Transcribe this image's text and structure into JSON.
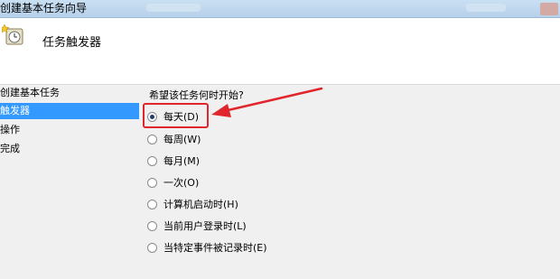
{
  "window": {
    "title": "创建基本任务向导"
  },
  "header": {
    "title": "任务触发器",
    "icon": "task-clock-icon"
  },
  "nav": {
    "items": [
      {
        "label": "创建基本任务",
        "selected": false
      },
      {
        "label": "触发器",
        "selected": true
      },
      {
        "label": "操作",
        "selected": false
      },
      {
        "label": "完成",
        "selected": false
      }
    ]
  },
  "trigger": {
    "prompt": "希望该任务何时开始?",
    "selected": "每天(D)",
    "options": [
      {
        "label": "每天(D)",
        "checked": true
      },
      {
        "label": "每周(W)",
        "checked": false
      },
      {
        "label": "每月(M)",
        "checked": false
      },
      {
        "label": "一次(O)",
        "checked": false
      },
      {
        "label": "计算机启动时(H)",
        "checked": false
      },
      {
        "label": "当前用户登录时(L)",
        "checked": false
      },
      {
        "label": "当特定事件被记录时(E)",
        "checked": false
      }
    ]
  },
  "annotation": {
    "color": "#e0262c"
  }
}
